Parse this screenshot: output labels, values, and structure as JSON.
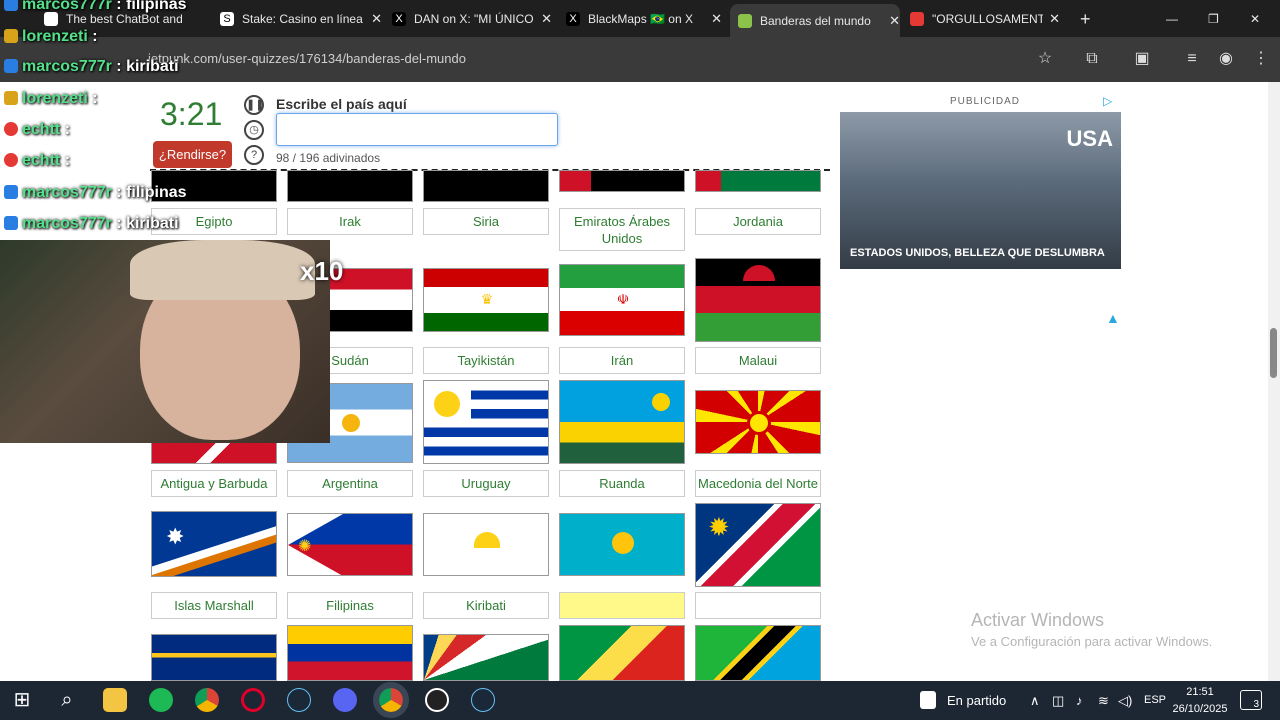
{
  "browser": {
    "tabs": [
      {
        "title": "The best ChatBot and",
        "active": false
      },
      {
        "title": "Stake: Casino en línea",
        "active": false
      },
      {
        "title": "DAN on X: \"MI ÚNICO",
        "active": false
      },
      {
        "title": "BlackMaps 🇧🇷 on X",
        "active": false
      },
      {
        "title": "Banderas del mundo",
        "active": true
      },
      {
        "title": "\"ORGULLOSAMENTE",
        "active": false
      }
    ],
    "close_glyph": "✕",
    "new_tab": "+",
    "url": "jetpunk.com/user-quizzes/176134/banderas-del-mundo",
    "window_controls": [
      "—",
      "❐",
      "✕"
    ]
  },
  "quiz": {
    "timer": "3:21",
    "give_up": "¿Rendirse?",
    "prompt": "Escribe el país aquí",
    "answer_value": "",
    "progress": "98 / 196 adivinados",
    "rows": [
      {
        "labels": [
          "Egipto",
          "Irak",
          "Siria",
          "Emiratos Árabes Unidos",
          "Jordania"
        ]
      },
      {
        "labels": [
          "",
          "Sudán",
          "Tayikistán",
          "Irán",
          "Malaui"
        ]
      },
      {
        "labels": [
          "Antigua y Barbuda",
          "Argentina",
          "Uruguay",
          "Ruanda",
          "Macedonia del Norte"
        ]
      },
      {
        "labels": [
          "Islas Marshall",
          "Filipinas",
          "Kiribati",
          "",
          ""
        ]
      }
    ]
  },
  "ad": {
    "label": "PUBLICIDAD",
    "brand": "USA",
    "tagline": "ESTADOS UNIDOS, BELLEZA QUE DESLUMBRA"
  },
  "windows_watermark": {
    "line1": "Activar Windows",
    "line2": "Ve a Configuración para activar Windows."
  },
  "chat": [
    {
      "user": "marcos777r",
      "msg": ": filipinas"
    },
    {
      "user": "lorenzeti",
      "msg": ":"
    },
    {
      "user": "marcos777r",
      "msg": ": kiribati"
    },
    {
      "user": "lorenzeti",
      "msg": ":"
    },
    {
      "user": "echtt",
      "msg": ":"
    },
    {
      "user": "echtt",
      "msg": ":"
    },
    {
      "user": "marcos777r",
      "msg": ": filipinas"
    },
    {
      "user": "marcos777r",
      "msg": ": kiribati"
    }
  ],
  "overlay": {
    "multiplier": "x10"
  },
  "taskbar": {
    "status": "En partido",
    "lang": "ESP",
    "time": "21:51",
    "date": "26/10/2025",
    "notifications": "3"
  }
}
